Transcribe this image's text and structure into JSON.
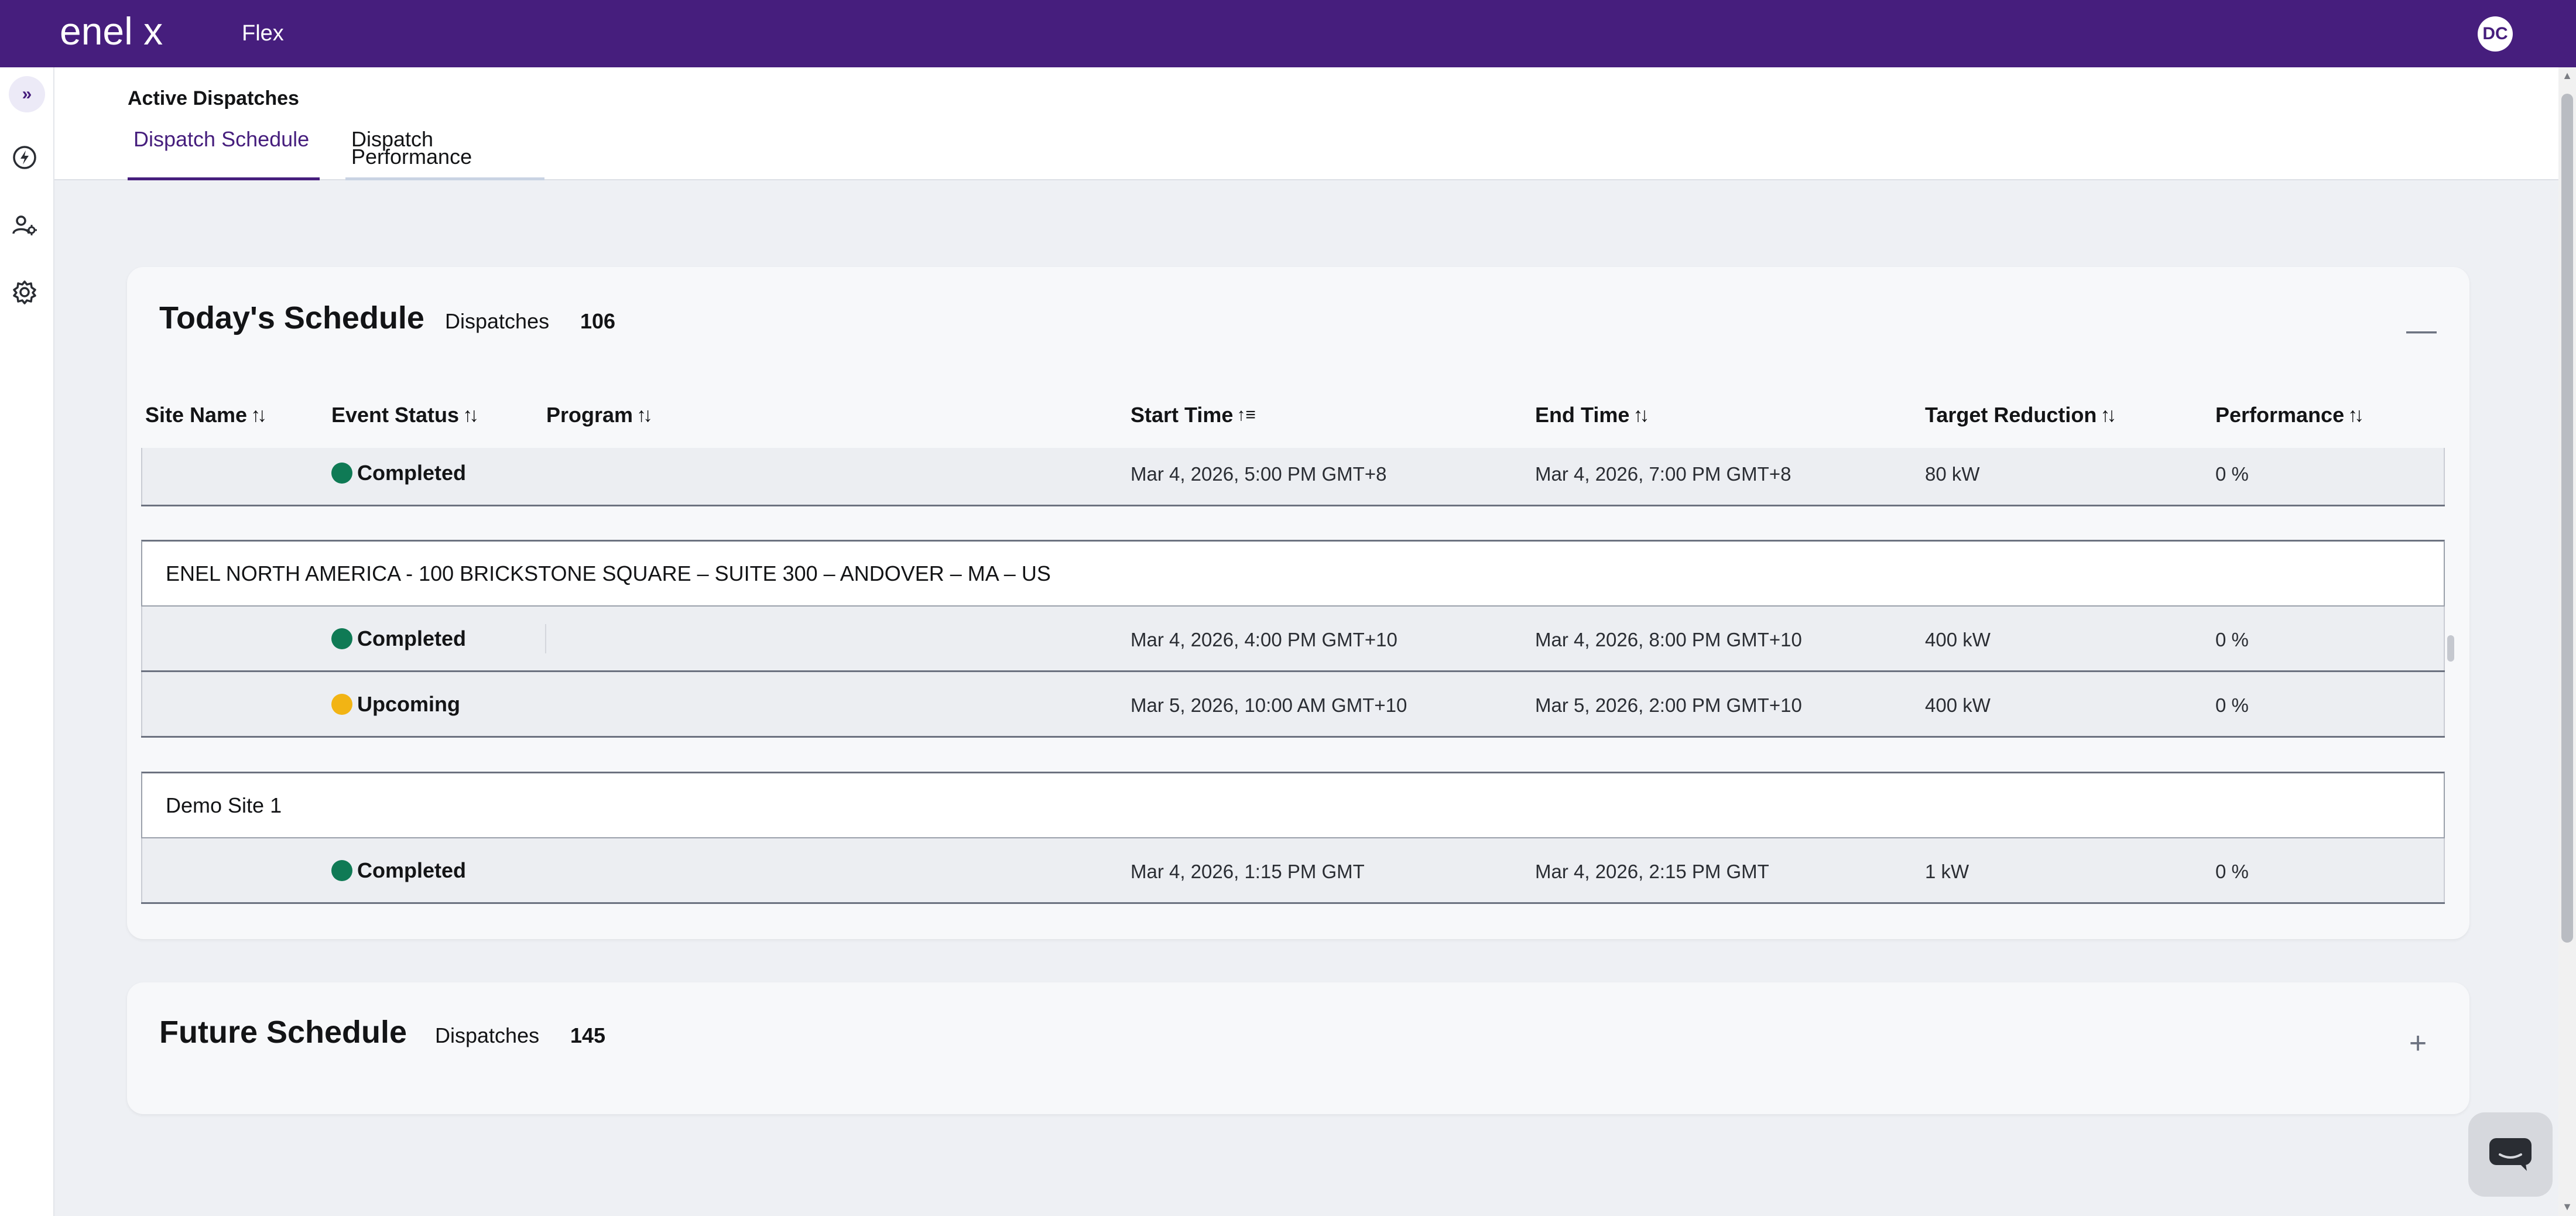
{
  "header": {
    "logo_text": "enel x",
    "app_name": "Flex",
    "user_initials": "DC",
    "brand_color": "#461e7d"
  },
  "siderail": {
    "items": [
      {
        "icon": "expand-icon",
        "glyph": "»"
      },
      {
        "icon": "lightning-icon"
      },
      {
        "icon": "user-settings-icon"
      },
      {
        "icon": "gear-icon"
      }
    ]
  },
  "page": {
    "title": "Active Dispatches",
    "tabs": [
      {
        "label": "Dispatch Schedule",
        "active": true
      },
      {
        "label": "Dispatch Performance",
        "active": false
      }
    ]
  },
  "today": {
    "title": "Today's Schedule",
    "dispatches_label": "Dispatches",
    "dispatches_count": "106",
    "toggle": "—",
    "columns": [
      "Site Name",
      "Event Status",
      "Program",
      "Start Time",
      "End Time",
      "Target Reduction",
      "Performance"
    ],
    "partial_row": {
      "status": "Completed",
      "start": "Mar 4, 2026, 5:00 PM GMT+8",
      "end": "Mar 4, 2026, 7:00 PM GMT+8",
      "target": "80 kW",
      "performance": "0 %"
    },
    "groups": [
      {
        "site": "ENEL NORTH AMERICA - 100 BRICKSTONE SQUARE – SUITE 300 – ANDOVER – MA – US",
        "rows": [
          {
            "status": "Completed",
            "start": "Mar 4, 2026, 4:00 PM GMT+10",
            "end": "Mar 4, 2026, 8:00 PM GMT+10",
            "target": "400 kW",
            "performance": "0 %"
          },
          {
            "status": "Upcoming",
            "start": "Mar 5, 2026, 10:00 AM GMT+10",
            "end": "Mar 5, 2026, 2:00 PM GMT+10",
            "target": "400 kW",
            "performance": "0 %"
          }
        ]
      },
      {
        "site": "Demo Site 1",
        "rows": [
          {
            "status": "Completed",
            "start": "Mar 4, 2026, 1:15 PM GMT",
            "end": "Mar 4, 2026, 2:15 PM GMT",
            "target": "1 kW",
            "performance": "0 %"
          }
        ]
      }
    ]
  },
  "future": {
    "title": "Future Schedule",
    "dispatches_label": "Dispatches",
    "dispatches_count": "145",
    "toggle": "+"
  },
  "colors": {
    "completed": "#0f7a55",
    "upcoming": "#f2b414"
  }
}
